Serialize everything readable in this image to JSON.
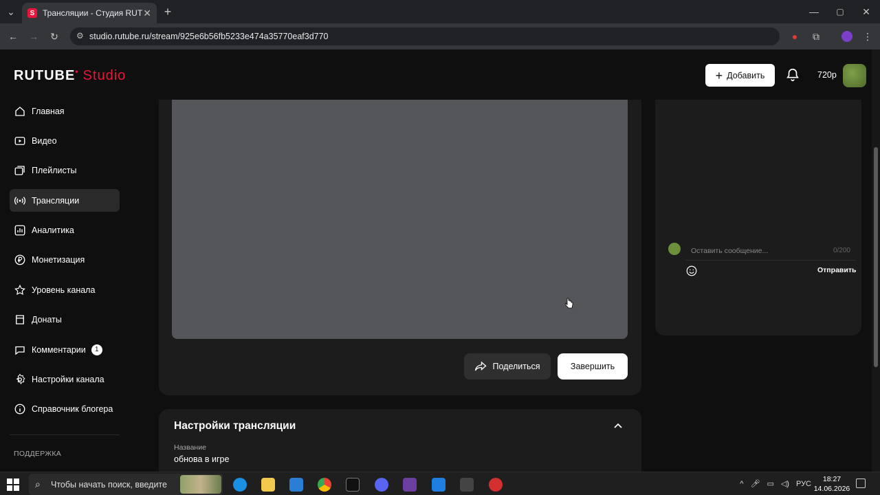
{
  "browser": {
    "tab_title": "Трансляции - Студия RUTUBE",
    "tab_favicon": "S",
    "url": "studio.rutube.ru/stream/925e6b56fb5233e474a35770eaf3d770"
  },
  "header": {
    "logo_main": "RUTUBE",
    "logo_studio": "Studio",
    "add_label": "Добавить",
    "quality": "720p"
  },
  "sidebar": {
    "items": [
      {
        "label": "Главная",
        "icon": "home-icon"
      },
      {
        "label": "Видео",
        "icon": "video-icon"
      },
      {
        "label": "Плейлисты",
        "icon": "playlist-icon"
      },
      {
        "label": "Трансляции",
        "icon": "broadcast-icon",
        "active": true
      },
      {
        "label": "Аналитика",
        "icon": "analytics-icon"
      },
      {
        "label": "Монетизация",
        "icon": "ruble-icon"
      },
      {
        "label": "Уровень канала",
        "icon": "star-icon"
      },
      {
        "label": "Донаты",
        "icon": "donate-icon"
      },
      {
        "label": "Комментарии",
        "icon": "comment-icon",
        "badge": "1"
      },
      {
        "label": "Настройки канала",
        "icon": "gear-icon"
      },
      {
        "label": "Справочник блогера",
        "icon": "info-icon"
      }
    ],
    "support_label": "ПОДДЕРЖКА"
  },
  "main": {
    "share_label": "Поделиться",
    "finish_label": "Завершить",
    "settings_title": "Настройки трансляции",
    "name_label": "Название",
    "name_value": "обнова в игре"
  },
  "chat": {
    "placeholder": "Оставить сообщение...",
    "counter": "0/200",
    "send_label": "Отправить"
  },
  "taskbar": {
    "search_placeholder": "Чтобы начать поиск, введите",
    "lang": "РУС",
    "time": "18:27",
    "date": "14.06.2026"
  },
  "colors": {
    "accent": "#ed143b",
    "background": "#0f0f0f",
    "card": "#1c1c1c",
    "player": "#55565a"
  }
}
